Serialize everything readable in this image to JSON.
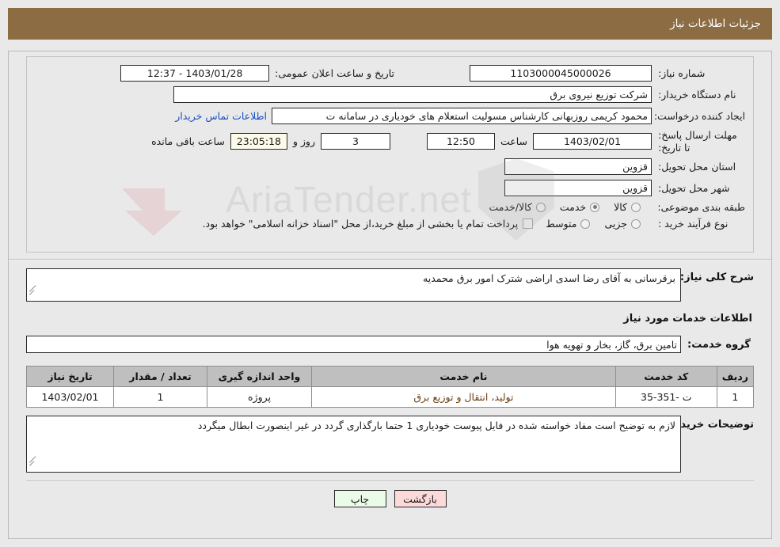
{
  "header": {
    "title": "جزئیات اطلاعات نیاز"
  },
  "form": {
    "need_number_label": "شماره نیاز:",
    "need_number_value": "1103000045000026",
    "announce_label": "تاریخ و ساعت اعلان عمومی:",
    "announce_value": "1403/01/28 - 12:37",
    "buyer_org_label": "نام دستگاه خریدار:",
    "buyer_org_value": "شرکت توزیع نیروی برق",
    "creator_label": "ایجاد کننده درخواست:",
    "creator_value": "محمود کریمی روزبهانی کارشناس  مسولیت استعلام های خودیاری در سامانه ت",
    "contact_link": "اطلاعات تماس خریدار",
    "deadline_label": "مهلت ارسال پاسخ: تا تاریخ:",
    "deadline_date": "1403/02/01",
    "hour_label": "ساعت",
    "deadline_time": "12:50",
    "days_value": "3",
    "days_label": "روز و",
    "countdown_value": "23:05:18",
    "remaining_label": "ساعت باقی مانده",
    "province_label": "استان محل تحویل:",
    "province_value": "قزوین",
    "city_label": "شهر محل تحویل:",
    "city_value": "قزوین",
    "category_label": "طبقه بندی موضوعی:",
    "category_options": [
      {
        "label": "کالا",
        "selected": false
      },
      {
        "label": "خدمت",
        "selected": true
      },
      {
        "label": "کالا/خدمت",
        "selected": false
      }
    ],
    "process_label": "نوع فرآیند خرید :",
    "process_options": [
      {
        "label": "جزیی",
        "selected": false
      },
      {
        "label": "متوسط",
        "selected": false
      }
    ],
    "treasury_note": "پرداخت تمام یا بخشی از مبلغ خرید،از محل \"اسناد خزانه اسلامی\" خواهد بود."
  },
  "description": {
    "label": "شرح کلی نیاز:",
    "value": "برقرسانی به آقای رضا اسدی اراضی شترک امور برق محمدیه"
  },
  "services_section": {
    "heading": "اطلاعات خدمات مورد نیاز",
    "group_label": "گروه خدمت:",
    "group_value": "تامین برق، گاز، بخار و تهویه هوا"
  },
  "table": {
    "columns": [
      "ردیف",
      "کد خدمت",
      "نام خدمت",
      "واحد اندازه گیری",
      "تعداد / مقدار",
      "تاریخ نیاز"
    ],
    "rows": [
      {
        "row_no": "1",
        "service_code": "ت -351-35",
        "service_name": "تولید، انتقال و توزیع برق",
        "unit": "پروژه",
        "quantity": "1",
        "need_date": "1403/02/01"
      }
    ]
  },
  "buyer_notes": {
    "label": "توضیحات خریدار:",
    "value": "لازم به توضیح است مفاد خواسته شده در فایل پیوست خودیاری 1 حتما بارگذاری گردد در غیر اینصورت ابطال میگردد"
  },
  "footer": {
    "print_label": "چاپ",
    "back_label": "بازگشت"
  },
  "watermark": {
    "text": "AriaTender.net"
  }
}
